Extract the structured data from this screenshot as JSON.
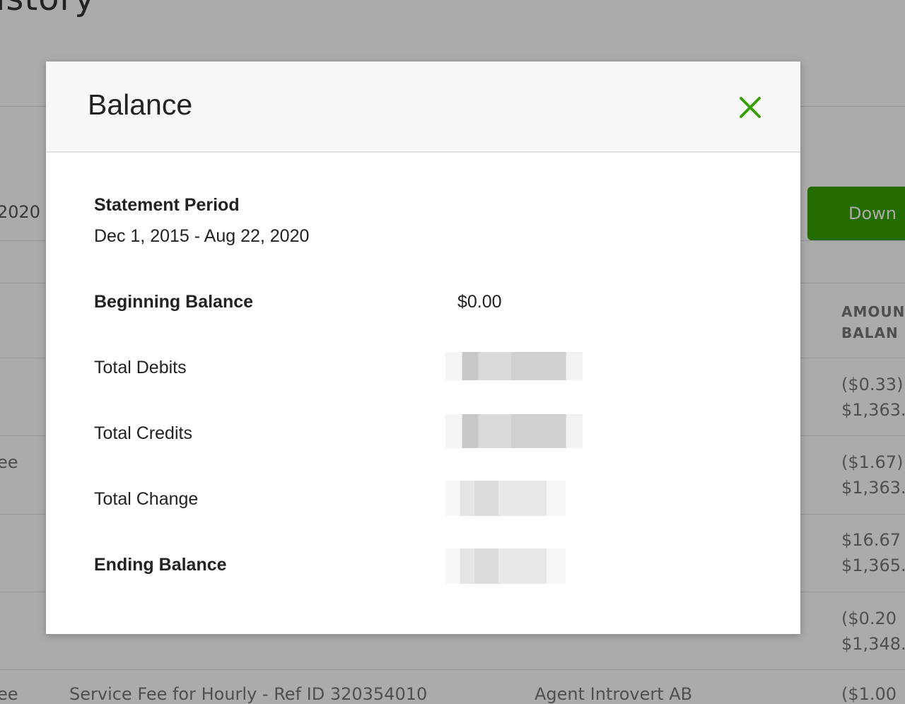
{
  "background": {
    "page_title": "istory",
    "date_fragment": "2020",
    "download_label": "Down",
    "column_header_line1": "AMOUN",
    "column_header_line2": "BALAN",
    "fee_fragment_1": "ee",
    "fee_fragment_2": "ee",
    "rows": [
      {
        "amount": "($0.33)",
        "balance": "$1,363."
      },
      {
        "amount": "($1.67)",
        "balance": "$1,363."
      },
      {
        "amount": "$16.67",
        "balance": "$1,365."
      },
      {
        "amount": "($0.20",
        "balance": "$1,348."
      }
    ],
    "last_row": {
      "description": "Service Fee for Hourly - Ref ID 320354010",
      "party": "Agent Introvert AB",
      "amount": "($1.00"
    }
  },
  "modal": {
    "title": "Balance",
    "close_icon": "close-x-icon",
    "accent_color": "#37a000",
    "statement_period_label": "Statement Period",
    "statement_period_value": "Dec 1, 2015 - Aug 22, 2020",
    "beginning_balance_label": "Beginning Balance",
    "beginning_balance_value": "$0.00",
    "total_debits_label": "Total Debits",
    "total_credits_label": "Total Credits",
    "total_change_label": "Total Change",
    "ending_balance_label": "Ending Balance"
  }
}
